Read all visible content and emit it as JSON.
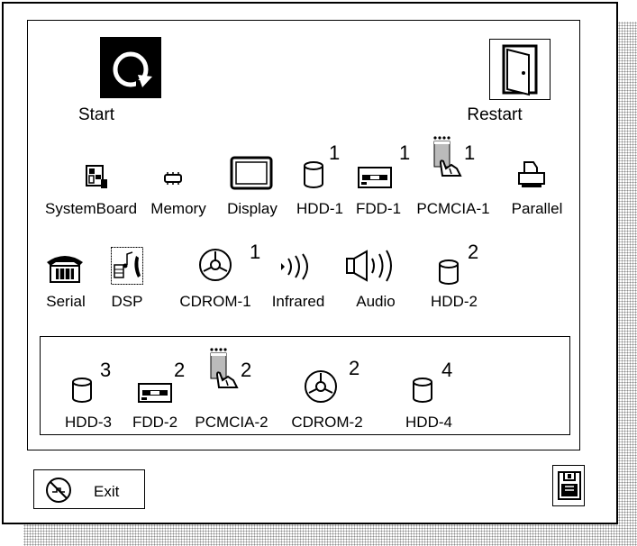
{
  "top_buttons": {
    "start_label": "Start",
    "restart_label": "Restart"
  },
  "devices_row1": [
    {
      "label": "SystemBoard",
      "icon": "systemboard-icon",
      "badge": ""
    },
    {
      "label": "Memory",
      "icon": "memory-chip-icon",
      "badge": ""
    },
    {
      "label": "Display",
      "icon": "display-icon",
      "badge": ""
    },
    {
      "label": "HDD-1",
      "icon": "hdd-icon",
      "badge": "1"
    },
    {
      "label": "FDD-1",
      "icon": "fdd-icon",
      "badge": "1"
    },
    {
      "label": "PCMCIA-1",
      "icon": "pcmcia-icon",
      "badge": "1"
    },
    {
      "label": "Parallel",
      "icon": "printer-icon",
      "badge": ""
    }
  ],
  "devices_row2": [
    {
      "label": "Serial",
      "icon": "telephone-icon",
      "badge": ""
    },
    {
      "label": "DSP",
      "icon": "dsp-icon",
      "badge": ""
    },
    {
      "label": "CDROM-1",
      "icon": "cdrom-icon",
      "badge": "1"
    },
    {
      "label": "Infrared",
      "icon": "infrared-icon",
      "badge": ""
    },
    {
      "label": "Audio",
      "icon": "speaker-icon",
      "badge": ""
    },
    {
      "label": "HDD-2",
      "icon": "hdd-icon",
      "badge": "2"
    }
  ],
  "devices_docked": [
    {
      "label": "HDD-3",
      "icon": "hdd-icon",
      "badge": "3"
    },
    {
      "label": "FDD-2",
      "icon": "fdd-icon",
      "badge": "2"
    },
    {
      "label": "PCMCIA-2",
      "icon": "pcmcia-icon",
      "badge": "2"
    },
    {
      "label": "CDROM-2",
      "icon": "cdrom-icon",
      "badge": "2"
    },
    {
      "label": "HDD-4",
      "icon": "hdd-icon",
      "badge": "4"
    }
  ],
  "footer": {
    "exit_label": "Exit"
  }
}
